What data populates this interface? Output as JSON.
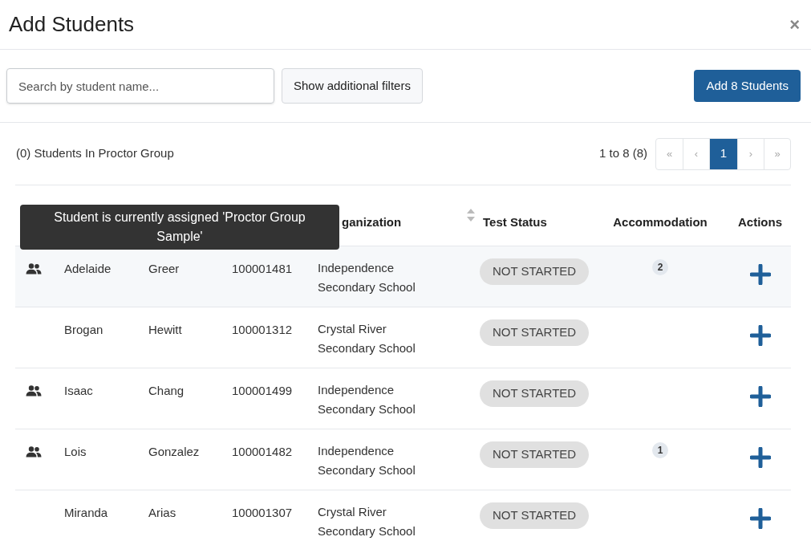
{
  "dialog": {
    "title": "Add Students",
    "close": "×"
  },
  "toolbar": {
    "search": {
      "placeholder": "Search by student name..."
    },
    "filters_button": "Show additional filters",
    "add_button": "Add 8 Students"
  },
  "group_label": "(0) Students In Proctor Group",
  "pagination": {
    "range": "1 to 8 (8)",
    "pages": [
      {
        "label": "«",
        "kind": "nav",
        "selected": false
      },
      {
        "label": "‹",
        "kind": "nav",
        "selected": false
      },
      {
        "label": "1",
        "kind": "page",
        "selected": true
      },
      {
        "label": "›",
        "kind": "nav",
        "selected": false
      },
      {
        "label": "»",
        "kind": "nav",
        "selected": false
      }
    ]
  },
  "table": {
    "columns": [
      {
        "label": "ganization",
        "sortable": true
      },
      {
        "label": "Test Status"
      },
      {
        "label": "Accommodation"
      },
      {
        "label": "Actions"
      }
    ],
    "rows": [
      {
        "grouped": true,
        "highlighted": true,
        "first": "Adelaide",
        "last": "Greer",
        "id": "100001481",
        "org": "Independence Secondary School",
        "status": "NOT STARTED",
        "accommodations": "2"
      },
      {
        "grouped": false,
        "highlighted": false,
        "first": "Brogan",
        "last": "Hewitt",
        "id": "100001312",
        "org": "Crystal River Secondary School",
        "status": "NOT STARTED"
      },
      {
        "grouped": true,
        "highlighted": false,
        "first": "Isaac",
        "last": "Chang",
        "id": "100001499",
        "org": "Independence Secondary School",
        "status": "NOT STARTED"
      },
      {
        "grouped": true,
        "highlighted": false,
        "first": "Lois",
        "last": "Gonzalez",
        "id": "100001482",
        "org": "Independence Secondary School",
        "status": "NOT STARTED",
        "accommodations": "1"
      },
      {
        "grouped": false,
        "highlighted": false,
        "first": "Miranda",
        "last": "Arias",
        "id": "100001307",
        "org": "Crystal River Secondary School",
        "status": "NOT STARTED"
      }
    ]
  },
  "tooltip": "Student is currently assigned 'Proctor Group Sample'"
}
